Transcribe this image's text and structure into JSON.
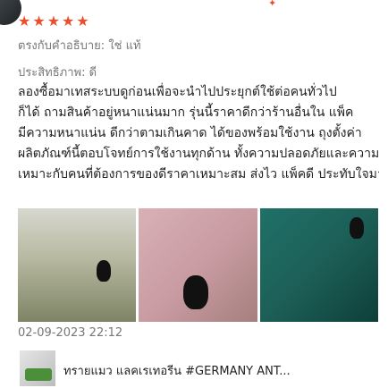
{
  "header": {
    "username": "",
    "right_text": ""
  },
  "review": {
    "stars": "★★★★★",
    "meta_line1": "ตรงกับคำอธิบาย: ใช่ แท้",
    "meta_line2": "ประสิทธิภาพ: ดี",
    "body_lines": [
      "ลองซื้อมาเทสระบบดูก่อนเพื่อจะนำไปประยุกต์ใช้ต่อคนทั่วไป",
      "ก็ได้ ถามสินค้าอยู่หนาแน่นมาก รุ่นนี้ราคาดีกว่าร้านอื่นใน แพ็ค",
      "มีความหนาแน่น ดีกว่าตามเกินคาด ได้ของพร้อมใช้งาน ถุงตั้งค่า",
      "ผลิตภัณฑ์นี้ตอบโจทย์การใช้งานทุกด้าน ทั้งความปลอดภัยและความสะดวก",
      "เหมาะกับคนที่ต้องการของดีราคาเหมาะสม ส่งไว แพ็คดี ประทับใจมาก"
    ],
    "date": "02-09-2023 22:12"
  },
  "product": {
    "name": "ทรายแมว แลคเรเทอรีน #GERMANY ANT..."
  }
}
